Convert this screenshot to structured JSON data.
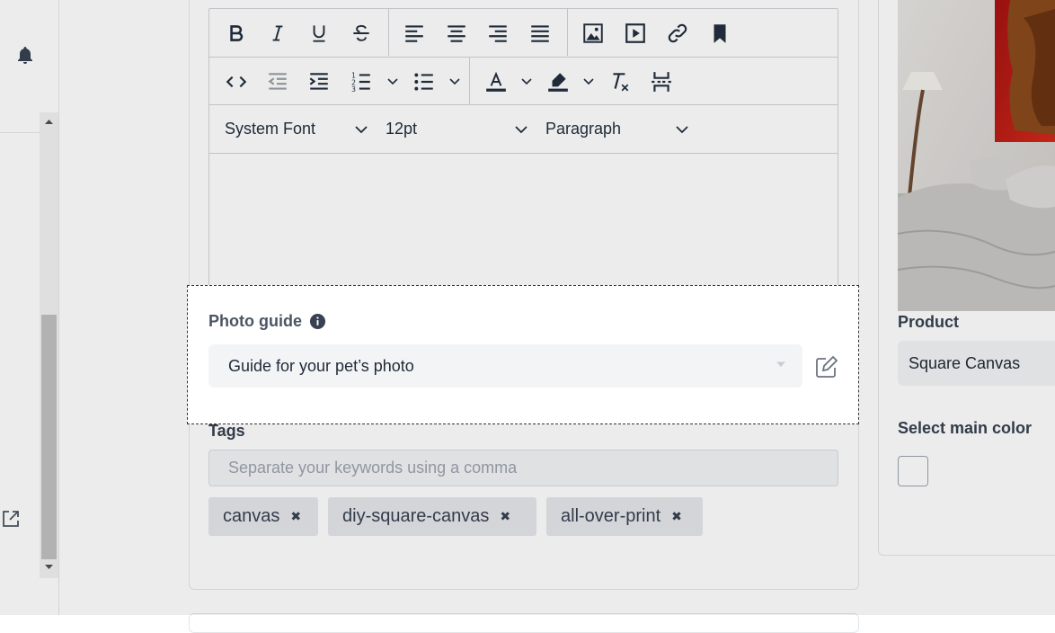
{
  "nav": {
    "notifications_icon": "bell-icon",
    "external_link_icon": "external-link-icon"
  },
  "editor": {
    "toolbar_row1": [
      "bold",
      "italic",
      "underline",
      "strikethrough",
      "align-left",
      "align-center",
      "align-right",
      "align-justify",
      "image",
      "media",
      "link",
      "bookmark"
    ],
    "toolbar_row2": [
      "source-code",
      "outdent",
      "indent",
      "numbered-list",
      "bullet-list",
      "text-color",
      "highlight-color",
      "clear-formatting",
      "page-break"
    ],
    "font_family": "System Font",
    "font_size": "12pt",
    "block_format": "Paragraph"
  },
  "photo_guide": {
    "label": "Photo guide",
    "selected": "Guide for your pet’s photo"
  },
  "tags": {
    "label": "Tags",
    "placeholder": "Separate your keywords using a comma",
    "items": [
      "canvas",
      "diy-square-canvas",
      "all-over-print"
    ]
  },
  "product": {
    "label": "Product",
    "value": "Square Canvas",
    "color_label": "Select main color"
  },
  "colors": {
    "overlay": "#000000",
    "swatch_border": "#9ca3af"
  }
}
